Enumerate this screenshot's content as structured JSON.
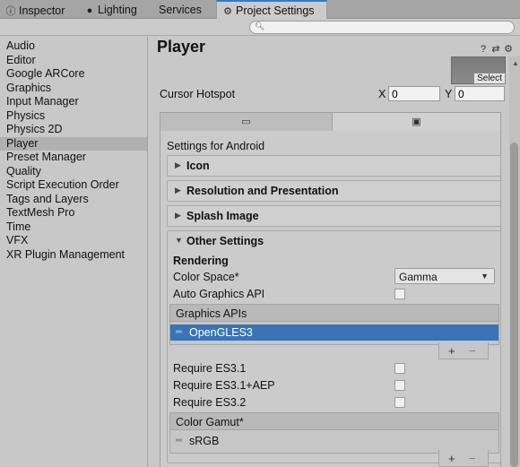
{
  "tabs": [
    {
      "label": "Inspector",
      "icon": "info-icon"
    },
    {
      "label": "Lighting",
      "icon": "bulb-icon"
    },
    {
      "label": "Services",
      "icon": ""
    },
    {
      "label": "Project Settings",
      "icon": "gear-icon"
    }
  ],
  "search": {
    "placeholder": "",
    "value": ""
  },
  "sidebar": {
    "items": [
      "Audio",
      "Editor",
      "Google ARCore",
      "Graphics",
      "Input Manager",
      "Physics",
      "Physics 2D",
      "Player",
      "Preset Manager",
      "Quality",
      "Script Execution Order",
      "Tags and Layers",
      "TextMesh Pro",
      "Time",
      "VFX",
      "XR Plugin Management"
    ],
    "selected": "Player"
  },
  "main": {
    "title": "Player",
    "select_label": "Select",
    "cursor_hotspot": {
      "label": "Cursor Hotspot",
      "x_label": "X",
      "x_value": "0",
      "y_label": "Y",
      "y_value": "0"
    },
    "settings_for": "Settings for Android",
    "sections": {
      "icon": "Icon",
      "resolution": "Resolution and Presentation",
      "splash": "Splash Image",
      "other": "Other Settings"
    },
    "rendering": "Rendering",
    "color_space": {
      "label": "Color Space*",
      "value": "Gamma"
    },
    "auto_graphics": {
      "label": "Auto Graphics API",
      "checked": false
    },
    "graphics_apis": {
      "header": "Graphics APIs",
      "items": [
        "OpenGLES3"
      ]
    },
    "require_es31": {
      "label": "Require ES3.1",
      "checked": false
    },
    "require_es31aep": {
      "label": "Require ES3.1+AEP",
      "checked": false
    },
    "require_es32": {
      "label": "Require ES3.2",
      "checked": false
    },
    "color_gamut": {
      "header": "Color Gamut*",
      "items": [
        "sRGB"
      ]
    },
    "list_add": "+",
    "list_remove": "−"
  },
  "colors": {
    "selection": "#3a73b6",
    "tab_accent": "#3a79bb",
    "background": "#c8c8c8"
  }
}
